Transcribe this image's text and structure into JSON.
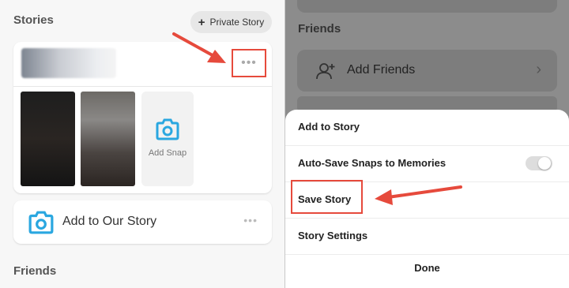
{
  "left": {
    "stories_title": "Stories",
    "private_story_label": "Private Story",
    "more_dots": "•••",
    "add_snap_label": "Add Snap",
    "add_to_our_story_label": "Add to Our Story",
    "our_story_dots": "•••",
    "friends_title": "Friends"
  },
  "right": {
    "friends_title": "Friends",
    "add_friends_label": "Add Friends",
    "chevron": "›",
    "sheet": {
      "items": [
        {
          "label": "Add to Story"
        },
        {
          "label": "Auto-Save Snaps to Memories",
          "toggle": false
        },
        {
          "label": "Save Story"
        },
        {
          "label": "Story Settings"
        }
      ],
      "done_label": "Done"
    }
  },
  "colors": {
    "accent_red": "#e64a3c",
    "snap_blue": "#2aa7e0"
  },
  "icons": [
    "plus-icon",
    "more-icon",
    "camera-icon",
    "add-friend-icon",
    "chevron-right-icon",
    "red-arrow"
  ]
}
